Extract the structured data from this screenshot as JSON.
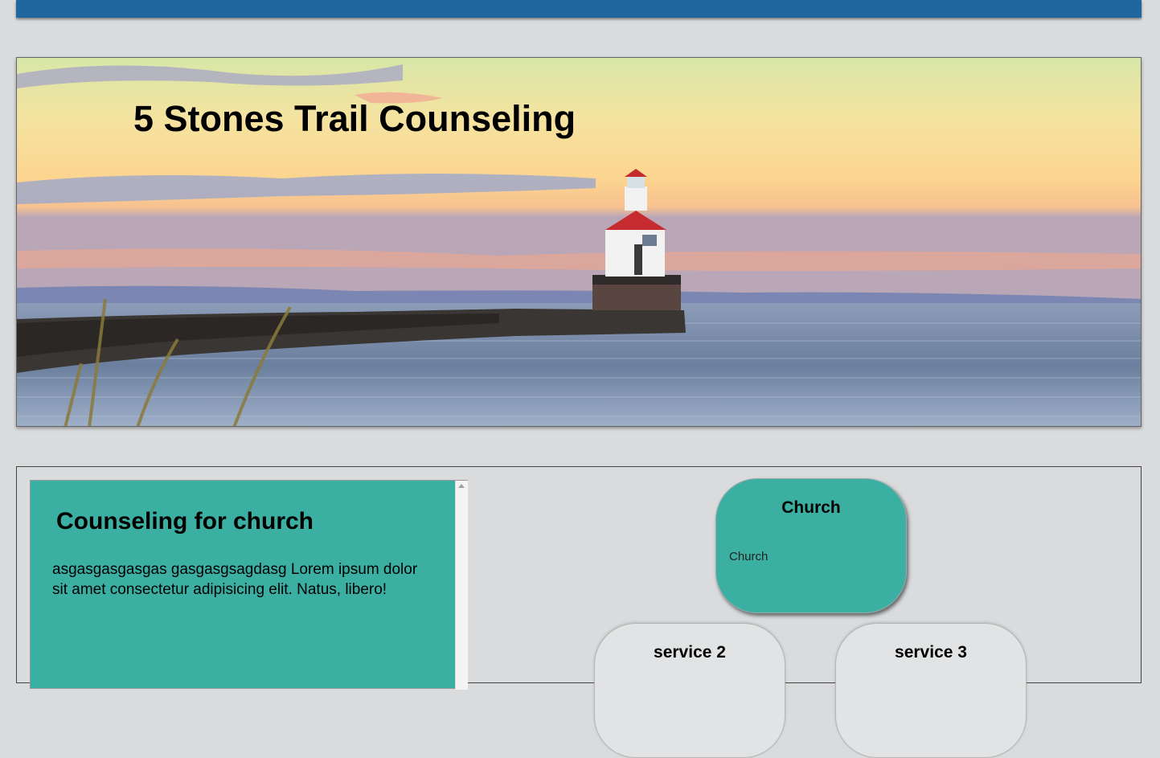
{
  "header": {
    "bar_color": "#21679f"
  },
  "hero": {
    "title": "5 Stones Trail Counseling",
    "image": "lighthouse-sunset"
  },
  "intro_card": {
    "heading": "Counseling for church",
    "body": "asgasgasgasgas gasgasgsagdasg Lorem ipsum dolor sit amet consectetur adipisicing elit. Natus, libero!",
    "bg_color": "#3aafa2"
  },
  "services": [
    {
      "title": "Church",
      "body": "Church"
    },
    {
      "title": "service 2",
      "body": ""
    },
    {
      "title": "service 3",
      "body": ""
    }
  ],
  "colors": {
    "page_bg": "#d9dbdd",
    "accent": "#3aafa2"
  }
}
